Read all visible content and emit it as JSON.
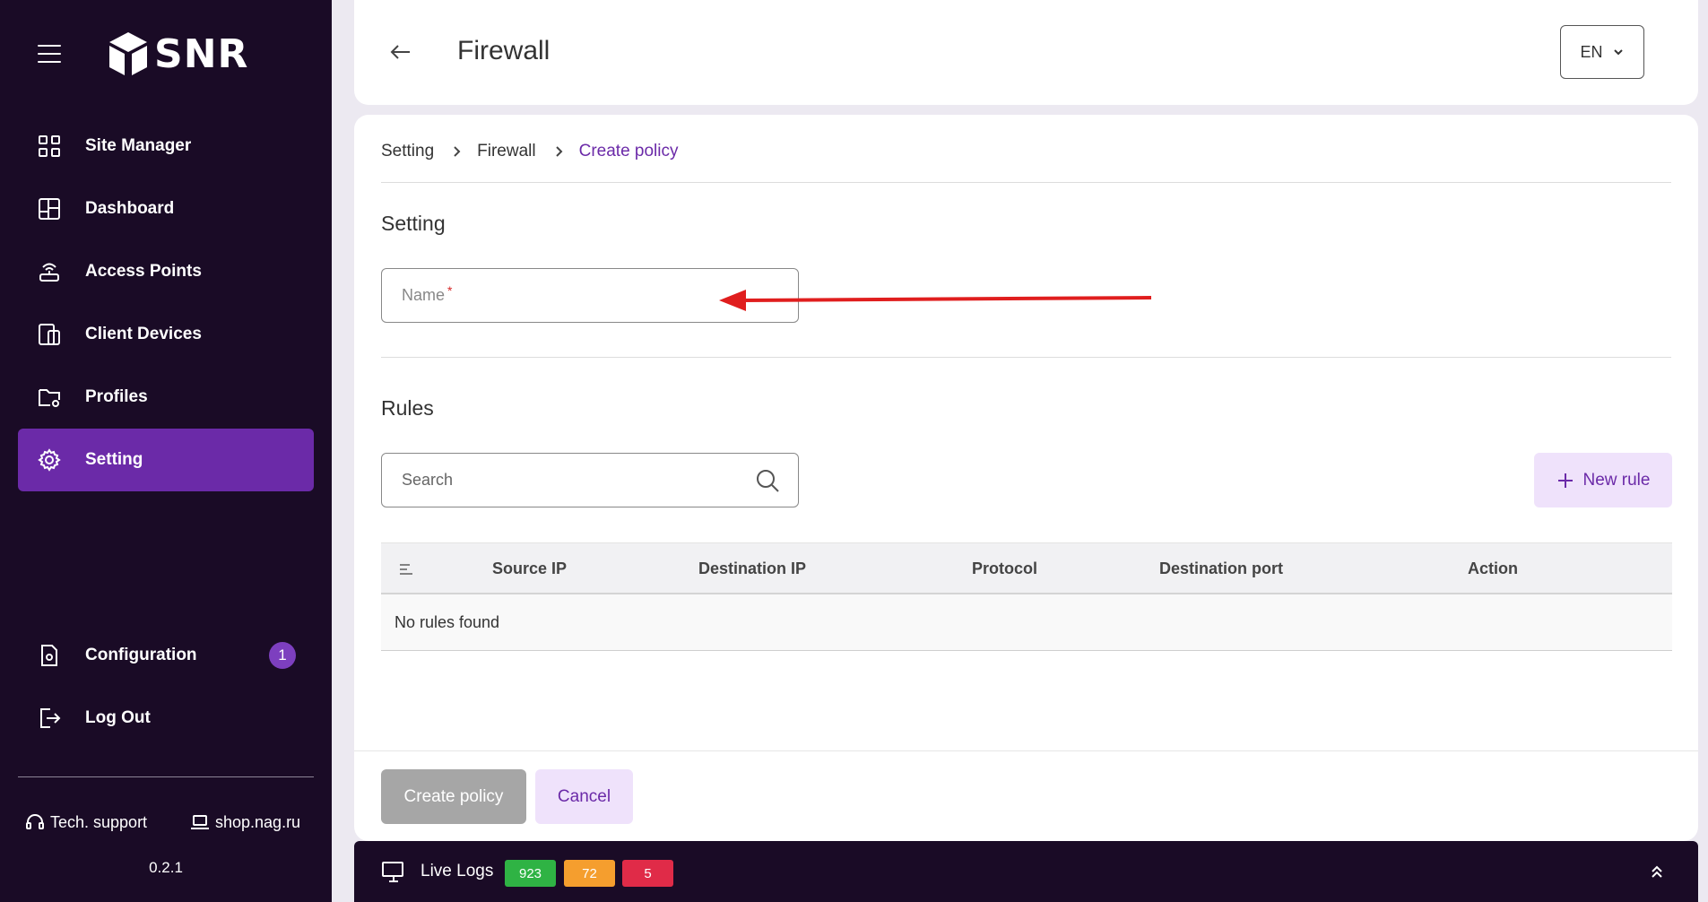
{
  "sidebar": {
    "logo": "SNR",
    "items": [
      {
        "label": "Site Manager",
        "icon": "grid-icon"
      },
      {
        "label": "Dashboard",
        "icon": "dashboard-icon"
      },
      {
        "label": "Access Points",
        "icon": "access-point-icon"
      },
      {
        "label": "Client Devices",
        "icon": "devices-icon"
      },
      {
        "label": "Profiles",
        "icon": "folder-gear-icon"
      },
      {
        "label": "Setting",
        "icon": "gear-icon",
        "active": true
      }
    ],
    "bottom_items": [
      {
        "label": "Configuration",
        "icon": "file-gear-icon",
        "badge": "1"
      },
      {
        "label": "Log Out",
        "icon": "logout-icon"
      }
    ],
    "footer": {
      "support": "Tech. support",
      "shop": "shop.nag.ru",
      "version": "0.2.1"
    }
  },
  "header": {
    "title": "Firewall",
    "lang": "EN"
  },
  "breadcrumb": {
    "items": [
      "Setting",
      "Firewall",
      "Create policy"
    ]
  },
  "setting_section": {
    "title": "Setting",
    "name_placeholder": "Name",
    "required_mark": "*"
  },
  "rules_section": {
    "title": "Rules",
    "search_placeholder": "Search",
    "new_rule_label": "New rule",
    "columns": [
      "Source IP",
      "Destination IP",
      "Protocol",
      "Destination port",
      "Action"
    ],
    "empty_text": "No rules found"
  },
  "actions": {
    "create_label": "Create policy",
    "cancel_label": "Cancel"
  },
  "live_logs": {
    "label": "Live Logs",
    "counts": [
      "923",
      "72",
      "5"
    ]
  },
  "colors": {
    "sidebar_bg": "#1a0b26",
    "accent": "#6b2aa8",
    "accent_light": "#efe2fb",
    "arrow": "#e01e1e"
  }
}
